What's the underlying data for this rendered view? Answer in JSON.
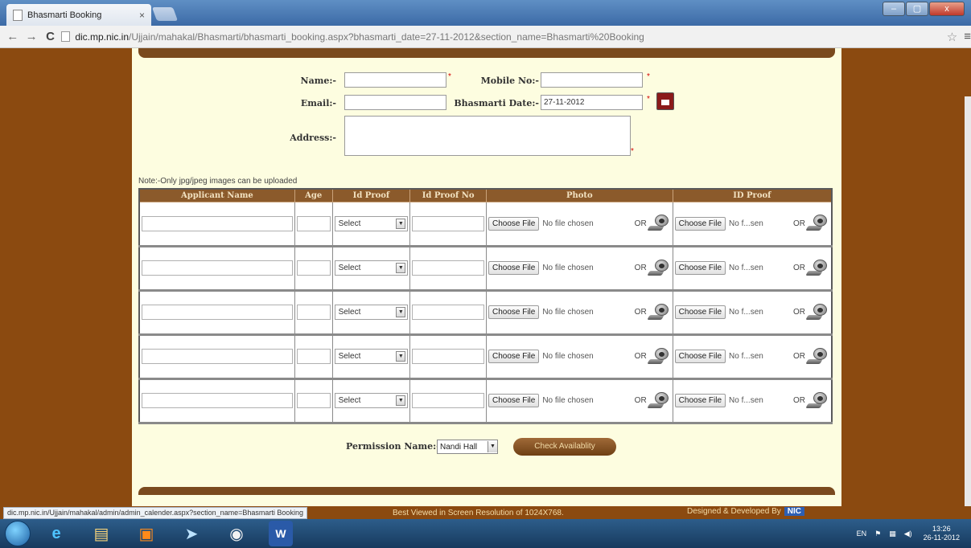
{
  "browser": {
    "tab_title": "Bhasmarti Booking",
    "tab_close": "×",
    "url_host": "dic.mp.nic.in",
    "url_path": "/Ujjain/mahakal/Bhasmarti/bhasmarti_booking.aspx?bhasmarti_date=27-11-2012&section_name=Bhasmarti%20Booking",
    "window_buttons": [
      "–",
      "▢",
      "x"
    ]
  },
  "form": {
    "name_label": "Name:-",
    "mobile_label": "Mobile No:-",
    "email_label": "Email:-",
    "bhasmarti_date_label": "Bhasmarti Date:-",
    "bhasmarti_date_value": "27-11-2012",
    "address_label": "Address:-",
    "required_mark": "*",
    "note": "Note:-Only jpg/jpeg images can be uploaded"
  },
  "table": {
    "headers": [
      "Applicant Name",
      "Age",
      "Id Proof",
      "Id Proof No",
      "Photo",
      "ID Proof"
    ],
    "rows": [
      {
        "select": "Select",
        "choose": "Choose File",
        "photo_nofile": "No file chosen",
        "or": "OR",
        "id_nofile": "No f...sen"
      },
      {
        "select": "Select",
        "choose": "Choose File",
        "photo_nofile": "No file chosen",
        "or": "OR",
        "id_nofile": "No f...sen"
      },
      {
        "select": "Select",
        "choose": "Choose File",
        "photo_nofile": "No file chosen",
        "or": "OR",
        "id_nofile": "No f...sen"
      },
      {
        "select": "Select",
        "choose": "Choose File",
        "photo_nofile": "No file chosen",
        "or": "OR",
        "id_nofile": "No f...sen"
      },
      {
        "select": "Select",
        "choose": "Choose File",
        "photo_nofile": "No file chosen",
        "or": "OR",
        "id_nofile": "No f...sen"
      }
    ]
  },
  "permission": {
    "label": "Permission Name:-",
    "selected": "Nandi Hall",
    "button": "Check Availablity"
  },
  "footer": {
    "status_url": "dic.mp.nic.in/Ujjain/mahakal/admin/admin_calender.aspx?section_name=Bhasmarti Booking",
    "best_view": "Best Viewed in Screen Resolution of 1024X768.",
    "designed_by": "Designed & Developed By",
    "nic": "NIC"
  },
  "taskbar": {
    "word_label": "W",
    "lang": "EN",
    "time": "13:26",
    "date": "26-11-2012"
  }
}
